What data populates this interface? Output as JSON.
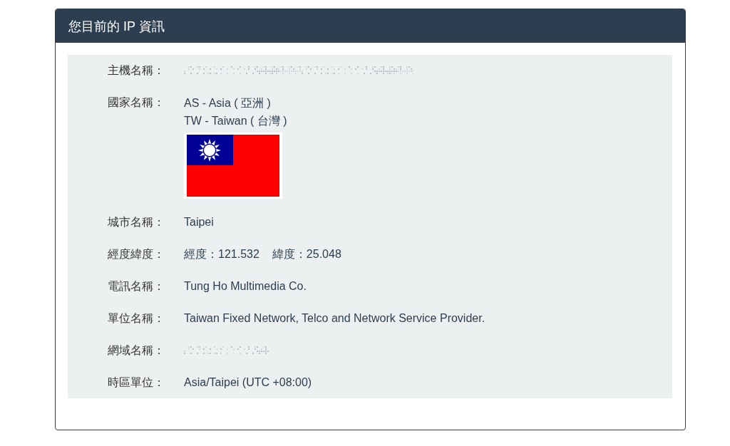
{
  "panel": {
    "title": "您目前的 IP 資訊"
  },
  "rows": [
    {
      "label": "主機名稱：",
      "kind": "redacted"
    },
    {
      "label": "國家名稱：",
      "kind": "country",
      "lines": [
        "AS - Asia ( 亞洲 )",
        "TW - Taiwan ( 台灣 )"
      ]
    },
    {
      "label": "城市名稱：",
      "kind": "text",
      "value": "Taipei"
    },
    {
      "label": "經度緯度：",
      "kind": "pairs",
      "values": [
        "經度：121.532",
        "緯度：25.048"
      ]
    },
    {
      "label": "電訊名稱：",
      "kind": "text",
      "value": "Tung Ho Multimedia Co."
    },
    {
      "label": "單位名稱：",
      "kind": "text",
      "value": "Taiwan Fixed Network, Telco and Network Service Provider."
    },
    {
      "label": "網域名稱：",
      "kind": "redacted"
    },
    {
      "label": "時區單位：",
      "kind": "text",
      "value": "Asia/Taipei (UTC +08:00)"
    }
  ]
}
